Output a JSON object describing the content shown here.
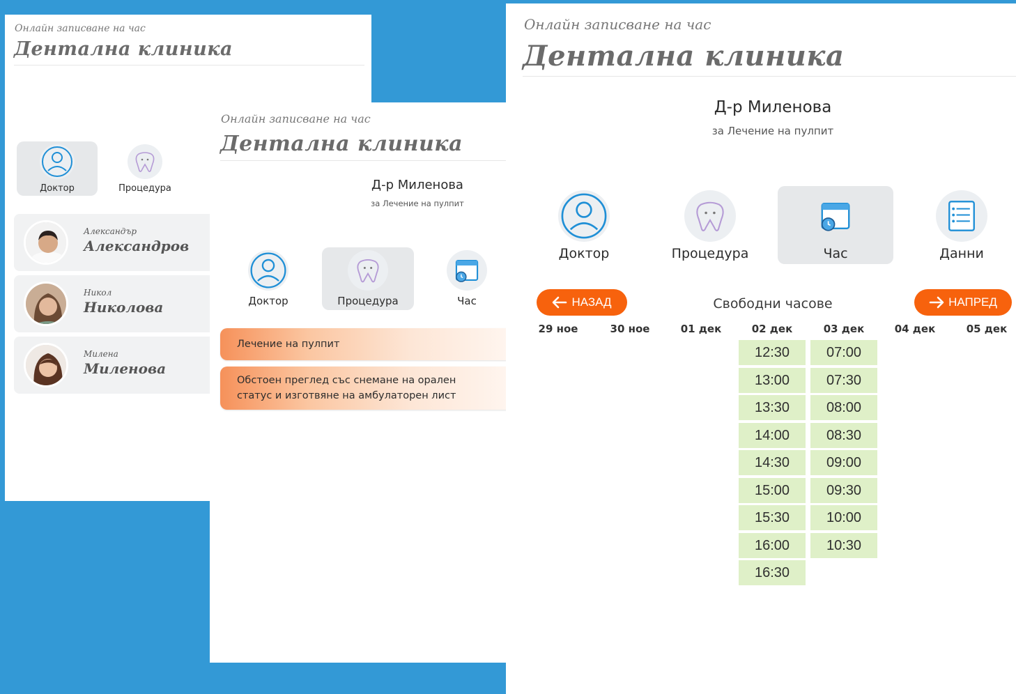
{
  "app": {
    "subtitle": "Онлайн записване на час",
    "title": "Дентална клиника"
  },
  "panel1": {
    "steps": [
      {
        "label": "Доктор",
        "icon": "doctor-icon",
        "active": true
      },
      {
        "label": "Процедура",
        "icon": "tooth-icon",
        "active": false
      }
    ],
    "doctors": [
      {
        "first": "Александър",
        "last": "Александров"
      },
      {
        "first": "Никол",
        "last": "Николова"
      },
      {
        "first": "Милена",
        "last": "Миленова"
      }
    ]
  },
  "panel2": {
    "doctor_name": "Д-р Миленова",
    "doctor_for": "за Лечение на пулпит",
    "steps": [
      {
        "label": "Доктор",
        "icon": "doctor-icon",
        "active": false
      },
      {
        "label": "Процедура",
        "icon": "tooth-icon",
        "active": true
      },
      {
        "label": "Час",
        "icon": "calendar-icon",
        "active": false
      }
    ],
    "procedures": [
      "Лечение на пулпит",
      "Обстоен преглед със снемане на орален статус и изготвяне на амбулаторен лист"
    ]
  },
  "panel3": {
    "doctor_name": "Д-р Миленова",
    "doctor_for": "за Лечение на пулпит",
    "steps": [
      {
        "label": "Доктор",
        "icon": "doctor-icon",
        "active": false
      },
      {
        "label": "Процедура",
        "icon": "tooth-icon",
        "active": false
      },
      {
        "label": "Час",
        "icon": "calendar-icon",
        "active": true
      },
      {
        "label": "Данни",
        "icon": "list-icon",
        "active": false
      }
    ],
    "back_label": "НАЗАД",
    "next_label": "НАПРЕД",
    "free_hours_label": "Свободни часове",
    "days": [
      "29 ное",
      "30 ное",
      "01 дек",
      "02 дек",
      "03 дек",
      "04 дек",
      "05 дек"
    ],
    "slots_day4": [
      "12:30",
      "13:00",
      "13:30",
      "14:00",
      "14:30",
      "15:00",
      "15:30",
      "16:00",
      "16:30"
    ],
    "slots_day5": [
      "07:00",
      "07:30",
      "08:00",
      "08:30",
      "09:00",
      "09:30",
      "10:00",
      "10:30"
    ]
  },
  "colors": {
    "background": "#3399d6",
    "accent_orange": "#f7620d",
    "slot_green": "#dff0c8",
    "icon_blue": "#1f8fd6"
  }
}
